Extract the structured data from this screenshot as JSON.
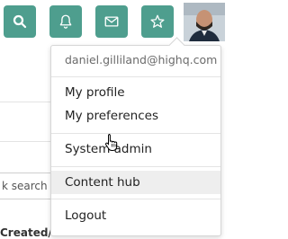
{
  "topbar": {
    "accent_color": "#4e9e8e",
    "buttons": [
      {
        "icon": "search-icon"
      },
      {
        "icon": "bell-icon"
      },
      {
        "icon": "mail-icon"
      },
      {
        "icon": "star-icon"
      }
    ]
  },
  "background": {
    "search_placeholder": "k search i",
    "bottom_label": "Created/Published"
  },
  "user_menu": {
    "email": "daniel.gilliland@highq.com",
    "items": [
      {
        "label": "My profile"
      },
      {
        "label": "My preferences"
      },
      {
        "label": "System admin"
      },
      {
        "label": "Content hub"
      },
      {
        "label": "Logout"
      }
    ],
    "hovered_item": "Content hub"
  }
}
